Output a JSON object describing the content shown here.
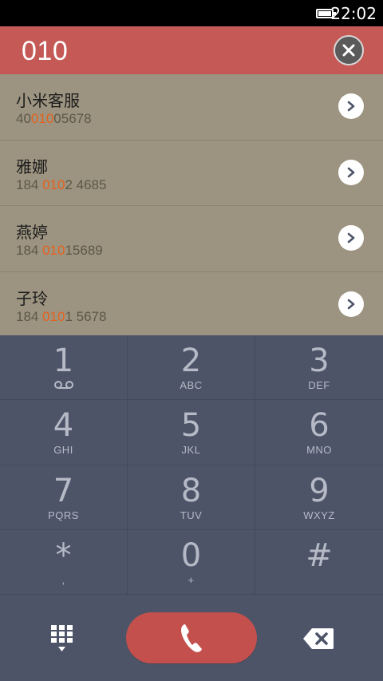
{
  "status_bar": {
    "time": "22:02"
  },
  "dialer": {
    "number": "010"
  },
  "contacts": [
    {
      "name": "小米客服",
      "number_prefix": "40",
      "number_match": "010",
      "number_suffix": "05678"
    },
    {
      "name": "雅娜",
      "number_prefix": "184 ",
      "number_match": "010",
      "number_suffix": "2 4685"
    },
    {
      "name": "燕婷",
      "number_prefix": "184 ",
      "number_match": "010",
      "number_suffix": "15689"
    },
    {
      "name": "子玲",
      "number_prefix": "184 ",
      "number_match": "010",
      "number_suffix": "1 5678"
    }
  ],
  "keypad": {
    "keys": [
      {
        "digit": "1",
        "letters": ""
      },
      {
        "digit": "2",
        "letters": "ABC"
      },
      {
        "digit": "3",
        "letters": "DEF"
      },
      {
        "digit": "4",
        "letters": "GHI"
      },
      {
        "digit": "5",
        "letters": "JKL"
      },
      {
        "digit": "6",
        "letters": "MNO"
      },
      {
        "digit": "7",
        "letters": "PQRS"
      },
      {
        "digit": "8",
        "letters": "TUV"
      },
      {
        "digit": "9",
        "letters": "WXYZ"
      },
      {
        "digit": "*",
        "letters": ","
      },
      {
        "digit": "0",
        "letters": "+"
      },
      {
        "digit": "#",
        "letters": ""
      }
    ]
  },
  "icons": {
    "battery": "battery-icon",
    "clear": "close-icon",
    "detail": "chevron-right-icon",
    "voicemail": "voicemail-icon",
    "dialpad": "dialpad-icon",
    "call": "phone-icon",
    "backspace": "backspace-icon"
  },
  "colors": {
    "header_bg": "#c45955",
    "results_bg": "#9c9480",
    "keypad_bg": "#4d5468",
    "match_highlight": "#e5611d",
    "call_button": "#c4504e"
  }
}
